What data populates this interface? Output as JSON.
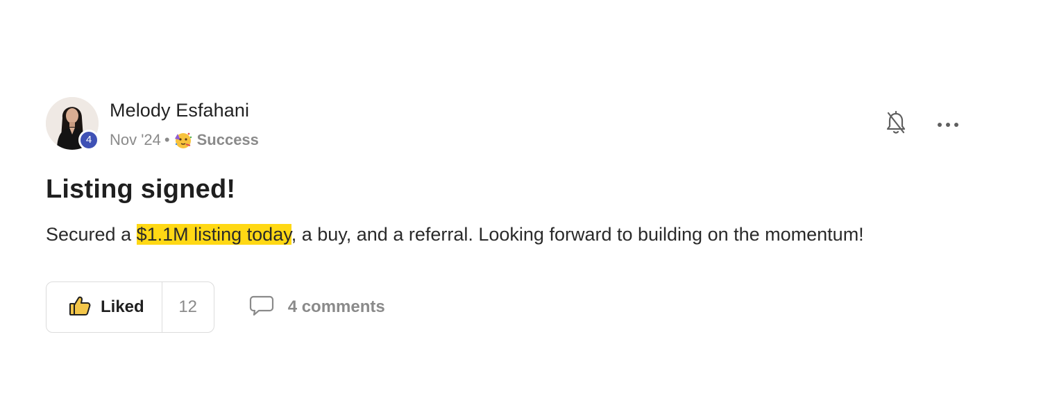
{
  "post": {
    "author": {
      "name": "Melody Esfahani",
      "level": "4"
    },
    "date": "Nov '24",
    "separator": "•",
    "category": {
      "emoji_icon": "partying-face-emoji",
      "label": "Success"
    },
    "title": "Listing signed!",
    "body": {
      "before": "Secured a ",
      "highlighted": "$1.1M listing today",
      "after": ", a buy, and a referral. Looking forward to building on the momentum!"
    },
    "header_actions": {
      "notifications_icon": "bell-off-icon",
      "more_icon": "more-horizontal-icon"
    },
    "reactions": {
      "like_icon": "thumbs-up-icon",
      "like_label": "Liked",
      "like_count": "12",
      "comment_icon": "comment-icon",
      "comments_label": "4 comments"
    }
  },
  "colors": {
    "highlight": "#ffd814",
    "level_badge": "#3f51b5",
    "muted_text": "#8a8a8a"
  }
}
